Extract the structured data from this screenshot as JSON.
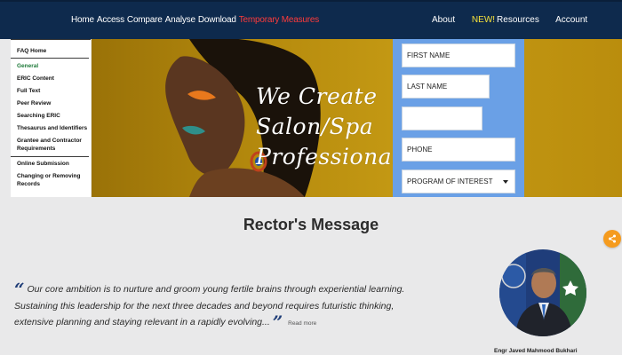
{
  "nav": {
    "left_items": [
      "Home",
      "Access",
      "Compare",
      "Analyse",
      "Download"
    ],
    "highlight_item": "Temporary Measures",
    "about": "About",
    "new_badge": "NEW!",
    "resources": "Resources",
    "account": "Account",
    "highlight_color": "#ff3b3b",
    "badge_color": "#f6e13a",
    "bar_color": "#0e2a4d"
  },
  "sidebar": {
    "items": [
      "FAQ Home",
      "General",
      "ERIC Content",
      "Full Text",
      "Peer Review",
      "Searching ERIC",
      "Thesaurus and Identifiers",
      "Grantee and Contractor Requirements",
      "Online Submission",
      "Changing or Removing Records"
    ],
    "active_color": "#1f7a3a"
  },
  "hero": {
    "line1": "We Create",
    "line2": "Salon/Spa",
    "line3": "Professionals"
  },
  "form": {
    "first_name": "FIRST NAME",
    "last_name": "LAST NAME",
    "blank_field": "",
    "phone": "PHONE",
    "program": "PROGRAM OF INTEREST",
    "panel_color": "#6aa0e6"
  },
  "rector": {
    "title": "Rector's Message",
    "line1": "Our core ambition is to nurture and groom young fertile brains through experiential learning.",
    "line2": "Sustaining this leadership for the next three decades and beyond requires futuristic thinking,",
    "line3": "extensive planning and staying relevant in a rapidly evolving...",
    "read_more": "Read more",
    "name": "Engr Javed Mahmood Bukhari"
  },
  "share": {
    "icon": "share-icon",
    "color": "#f59b1e"
  }
}
